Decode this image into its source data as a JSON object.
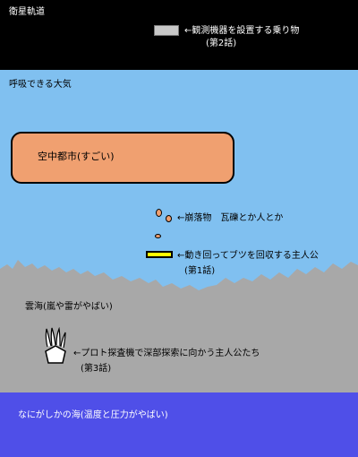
{
  "orbit": {
    "title": "衛星軌道",
    "vehicle_label_line1": "←観測機器を設置する乗り物",
    "vehicle_label_line2": "(第2話)"
  },
  "atmosphere": {
    "title": "呼吸できる大気"
  },
  "city": {
    "label": "空中都市(すごい)"
  },
  "debris": {
    "label": "←崩落物　瓦礫とか人とか"
  },
  "collector": {
    "label_line1": "←動き回ってブツを回収する主人公",
    "label_line2": "(第1話)"
  },
  "cloud_sea": {
    "title": "雲海(嵐や雷がやばい)"
  },
  "probe": {
    "label_line1": "←プロト探査機で深部探索に向かう主人公たち",
    "label_line2": "(第3話)"
  },
  "deep_sea": {
    "title": "なにがしかの海(温度と圧力がやばい)"
  },
  "colors": {
    "orbit": "#000000",
    "sky": "#80c0f0",
    "city": "#f0a070",
    "cloud": "#a8a8a8",
    "collector": "#ffff00",
    "deep_sea": "#4f4fe8",
    "vehicle": "#c8c8c8"
  }
}
